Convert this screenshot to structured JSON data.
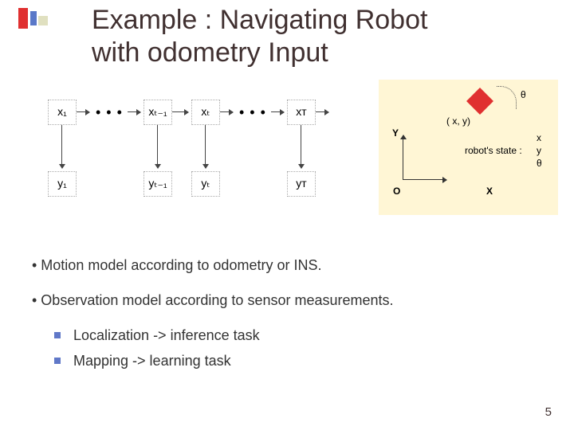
{
  "title_line1": "Example : Navigating Robot",
  "title_line2": "with odometry Input",
  "hmm": {
    "x1": "x₁",
    "xtm1": "xₜ₋₁",
    "xt": "xₜ",
    "xT": "xᴛ",
    "y1": "y₁",
    "ytm1": "yₜ₋₁",
    "yt": "yₜ",
    "yT": "yᴛ",
    "dots": "• • •"
  },
  "inset": {
    "theta": "θ",
    "xy": "( x, y)",
    "Y": "Y",
    "X": "X",
    "O": "O",
    "state_label": "robot's state :",
    "state_vec_x": "x",
    "state_vec_y": "y",
    "state_vec_th": "θ"
  },
  "bullets": {
    "b1": "• Motion model according to odometry or INS.",
    "b2": "• Observation model according to sensor measurements.",
    "s1": "Localization -> inference task",
    "s2": "Mapping -> learning task"
  },
  "page": "5"
}
